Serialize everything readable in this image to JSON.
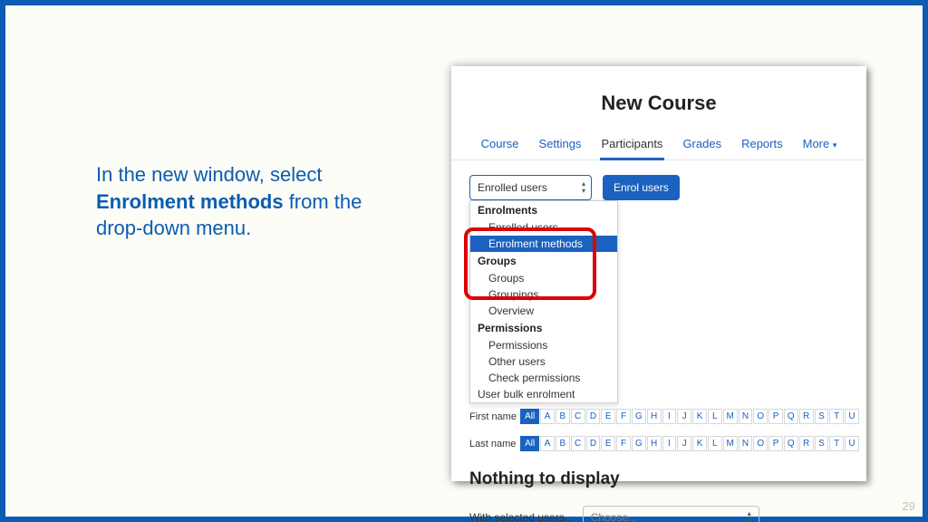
{
  "instruction": {
    "pre": "In the new window, select ",
    "bold": "Enrolment methods",
    "post": " from the drop-down menu."
  },
  "page_number": "29",
  "screenshot": {
    "title": "New Course",
    "tabs": [
      "Course",
      "Settings",
      "Participants",
      "Grades",
      "Reports",
      "More"
    ],
    "active_tab": 2,
    "selector_value": "Enrolled users",
    "enrol_button": "Enrol users",
    "dropdown_groups": [
      {
        "label": "Enrolments",
        "options": [
          "Enrolled users",
          "Enrolment methods"
        ]
      },
      {
        "label": "Groups",
        "options": [
          "Groups",
          "Groupings",
          "Overview"
        ]
      },
      {
        "label": "Permissions",
        "options": [
          "Permissions",
          "Other users",
          "Check permissions"
        ]
      }
    ],
    "dropdown_last": "User bulk enrolment",
    "match_selector": "ect",
    "first_name_label": "First name",
    "last_name_label": "Last name",
    "letters_all": "All",
    "letters": [
      "A",
      "B",
      "C",
      "D",
      "E",
      "F",
      "G",
      "H",
      "I",
      "J",
      "K",
      "L",
      "M",
      "N",
      "O",
      "P",
      "Q",
      "R",
      "S",
      "T",
      "U"
    ],
    "nothing": "Nothing to display",
    "with_selected_label": "With selected users...",
    "with_selected_value": "Choose..."
  }
}
